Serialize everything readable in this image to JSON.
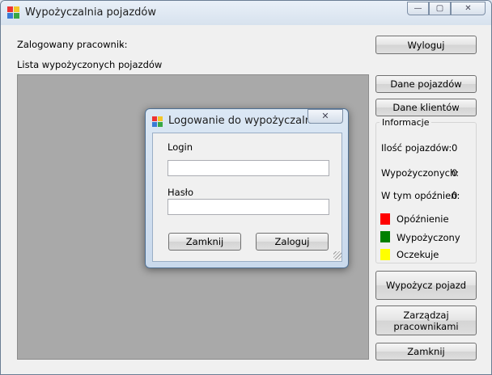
{
  "window": {
    "title": "Wypożyczalnia pojazdów",
    "controls": {
      "minimize": "—",
      "maximize": "▢",
      "close": "✕"
    }
  },
  "header": {
    "logged_label": "Zalogowany pracownik:",
    "logged_value": "-",
    "list_label": "Lista wypożyczonych pojazdów"
  },
  "buttons": {
    "logout": "Wyloguj",
    "vehicles": "Dane pojazdów",
    "clients": "Dane klientów",
    "rent": "Wypożycz pojazd",
    "manage_line1": "Zarządzaj",
    "manage_line2": "pracownikami",
    "close": "Zamknij"
  },
  "info": {
    "title": "Informacje",
    "count_label": "Ilość pojazdów:",
    "count_value": "0",
    "rented_label": "Wypożyczonych:",
    "rented_value": "0",
    "delayed_label": "W tym opóźnień:",
    "delayed_value": "0",
    "legend": [
      {
        "label": "Opóźnienie",
        "color": "#ff0000"
      },
      {
        "label": "Wypożyczony",
        "color": "#008000"
      },
      {
        "label": "Oczekuje",
        "color": "#ffff00"
      }
    ]
  },
  "dialog": {
    "title": "Logowanie do wypożyczalni a...",
    "close_glyph": "✕",
    "login_label": "Login",
    "login_value": "",
    "password_label": "Hasło",
    "password_value": "",
    "cancel_label": "Zamknij",
    "submit_label": "Zaloguj"
  }
}
